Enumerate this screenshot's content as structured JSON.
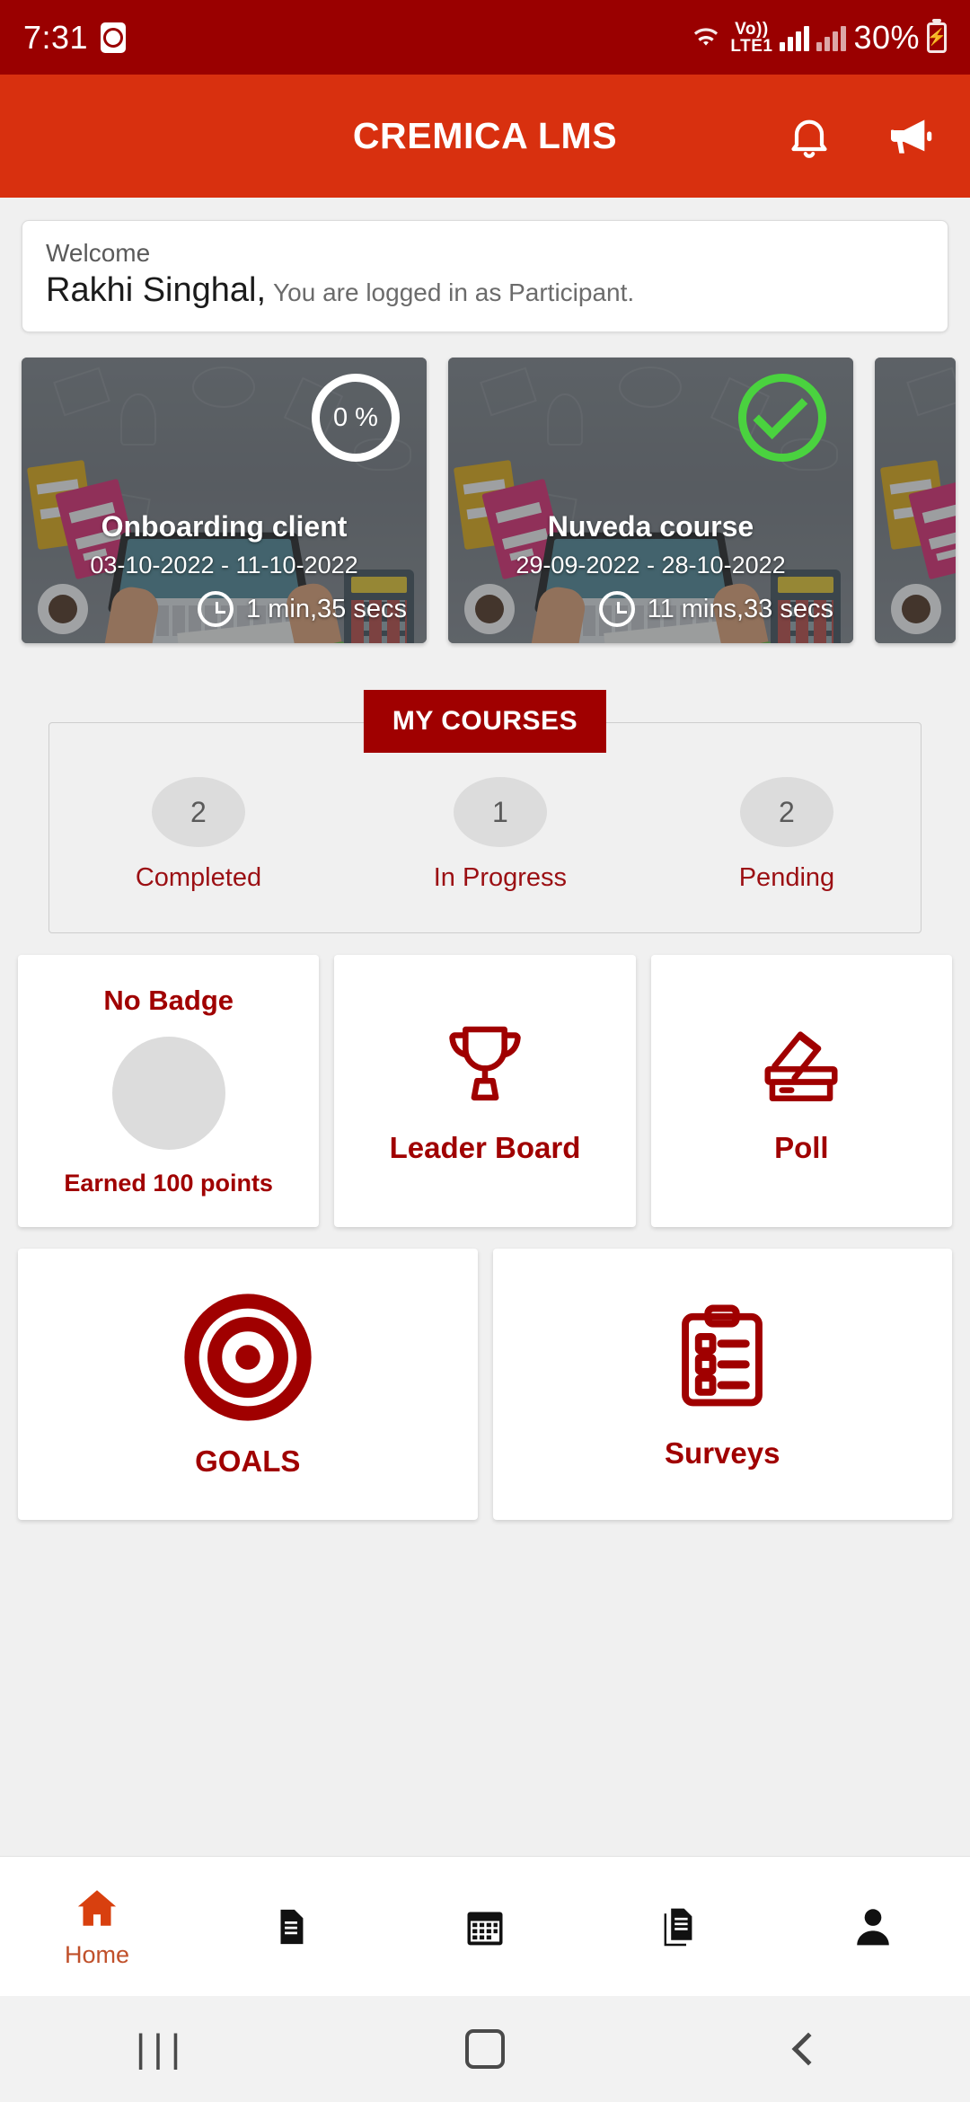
{
  "status_bar": {
    "time": "7:31",
    "alarm_icon": "alarm-icon",
    "wifi_icon": "wifi-icon",
    "volte_top": "Vo))",
    "volte_bottom": "LTE1",
    "battery_percent": "30%",
    "battery_icon": "battery-charging-icon"
  },
  "app_bar": {
    "title": "CREMICA LMS",
    "notification_icon": "bell-icon",
    "announcement_icon": "megaphone-icon",
    "background_color": "#d8300f"
  },
  "welcome": {
    "label": "Welcome",
    "name": "Rakhi Singhal,",
    "subtitle": "You are logged in as Participant."
  },
  "courses_carousel": [
    {
      "title": "Onboarding client",
      "start_date": "03-10-2022",
      "separator": "-",
      "end_date": "11-10-2022",
      "progress": "0 %",
      "status": "in-progress",
      "duration": "1 min,35 secs",
      "clock_icon": "clock-icon"
    },
    {
      "title": "Nuveda course",
      "start_date": "29-09-2022",
      "separator": "-",
      "end_date": "28-10-2022",
      "progress": "100 %",
      "status": "completed",
      "duration": "11 mins,33 secs",
      "clock_icon": "clock-icon"
    }
  ],
  "my_courses": {
    "tab_label": "MY COURSES",
    "tab_color": "#a00000",
    "stats": [
      {
        "count": "2",
        "label": "Completed"
      },
      {
        "count": "1",
        "label": "In Progress"
      },
      {
        "count": "2",
        "label": "Pending"
      }
    ]
  },
  "tiles": {
    "badge": {
      "title": "No Badge",
      "points": "Earned 100 points",
      "icon": "badge-circle-icon"
    },
    "leader_board": {
      "label": "Leader Board",
      "icon": "trophy-icon"
    },
    "poll": {
      "label": "Poll",
      "icon": "ballot-box-icon"
    },
    "goals": {
      "label": "GOALS",
      "icon": "target-icon"
    },
    "surveys": {
      "label": "Surveys",
      "icon": "clipboard-checklist-icon"
    },
    "accent_color": "#a00000"
  },
  "bottom_nav": [
    {
      "label": "Home",
      "icon": "home-icon",
      "active": true
    },
    {
      "label": "",
      "icon": "document-icon",
      "active": false
    },
    {
      "label": "",
      "icon": "calendar-icon",
      "active": false
    },
    {
      "label": "",
      "icon": "copy-pages-icon",
      "active": false
    },
    {
      "label": "",
      "icon": "person-icon",
      "active": false
    }
  ],
  "system_nav": {
    "recents_icon": "recents-icon",
    "home_icon": "home-square-icon",
    "back_icon": "back-chevron-icon"
  }
}
